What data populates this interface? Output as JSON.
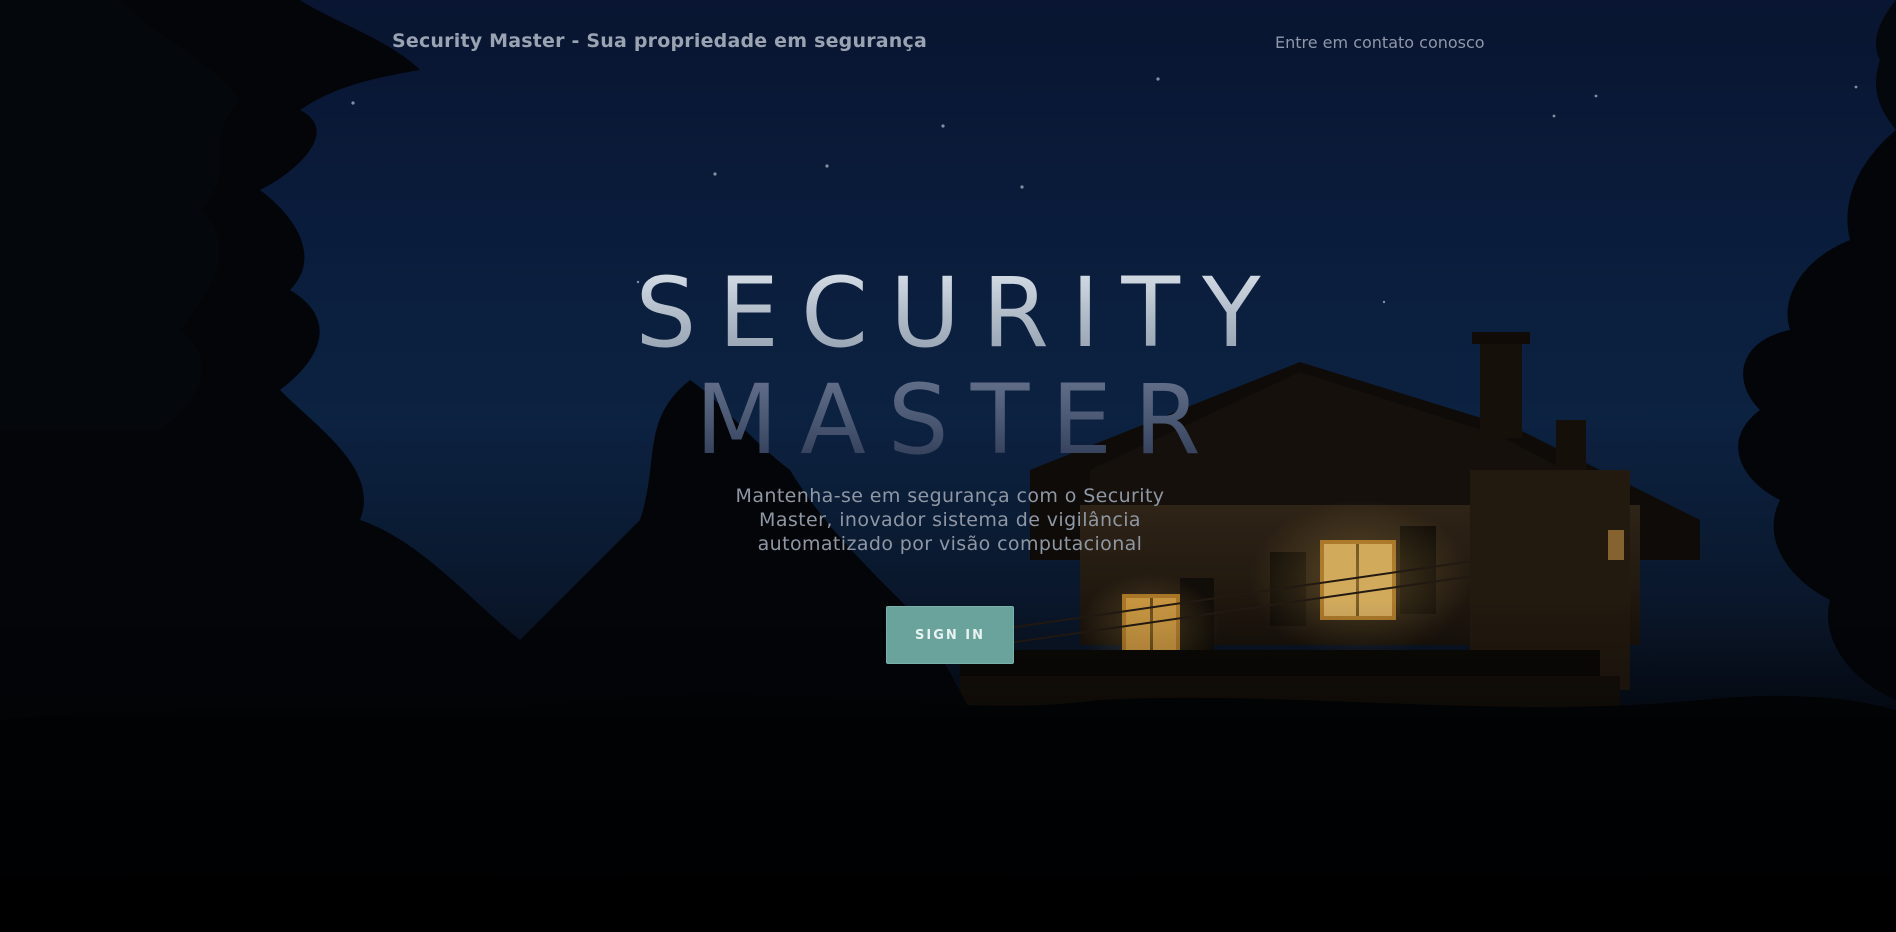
{
  "header": {
    "brand_title": "Security Master - Sua propriedade em segurança",
    "contact_link": "Entre em contato conosco"
  },
  "hero": {
    "title_line1": "SECURITY",
    "title_line2": "MASTER",
    "tagline": "Mantenha-se em segurança com o Security Master, inovador sistema de vigilância automatizado por visão computacional",
    "signin_label": "SIGN IN"
  },
  "colors": {
    "sky_top": "#0b1a3c",
    "sky_mid": "#0f2a50",
    "foliage": "#05080c",
    "window_glow": "#f0b040",
    "button": "#6aa29c",
    "text_muted": "#8f97a4"
  },
  "background": {
    "image": "night-house-trees-photo"
  }
}
